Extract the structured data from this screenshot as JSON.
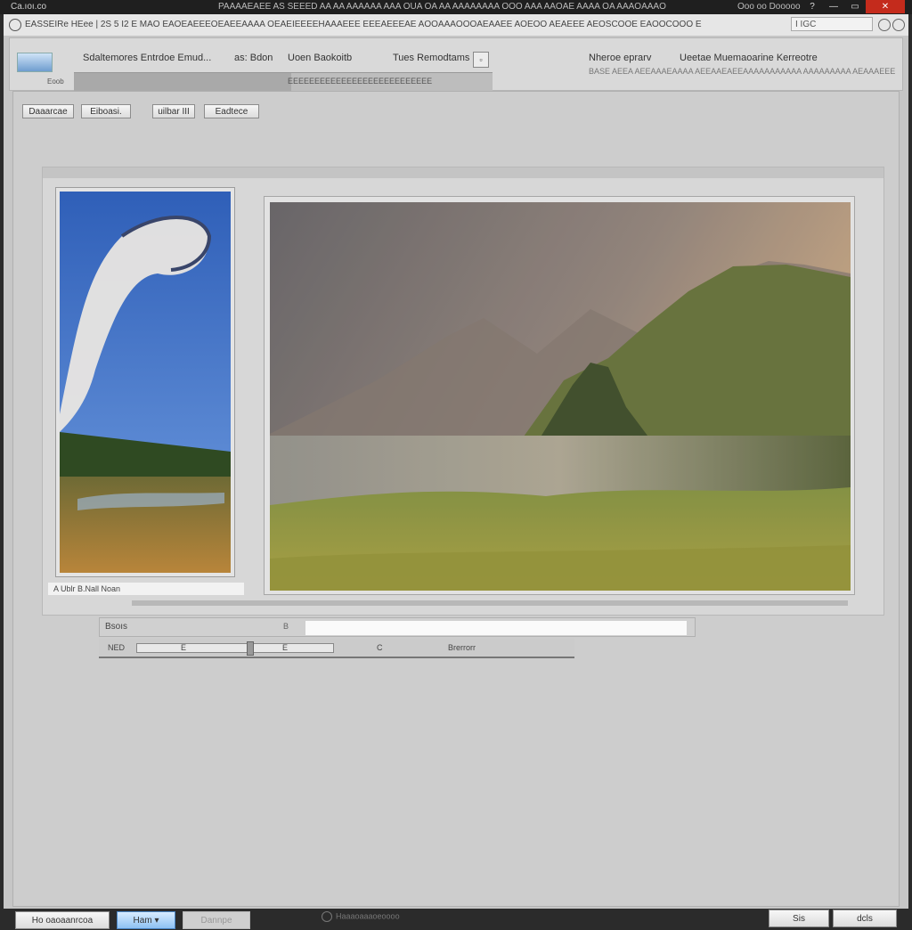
{
  "window": {
    "title": "Ca.ıoı.co",
    "center_text": "PAAAAEAEE AS SEEED AA AA AAAAAA AAA OUA OA AA AAAAAAAA OOO AAA AAOAE AAAA OA AAAOAAAO",
    "right_text": "Ooo oo Dooooo",
    "min_label": "—",
    "close_label": "✕"
  },
  "address": {
    "url": "EASSEIRe HEee | 2S 5 I2 E MAO EAOEAEEEOEAEEAAAA OEAEIEEEEHAAAEEE EEEAEEEAE AOOAAAOOOAEAAEE AOEOO AEAEEE AEOSCOOE EAOOCOOO EEEEEEEE",
    "search_value": "I  IGC"
  },
  "toolbar": {
    "item1": "Sdaltemores Entrdoe Emud...",
    "item2": "as: Bdon",
    "item3": "Uoen Baokoitb",
    "item4": "Tues Remodtams",
    "box_glyph": "▫",
    "progress": 0.52,
    "progress_text": "EEEEEEEEEEEEEEEEEEEEEEEEEEE",
    "small_label": "Eoob",
    "right1": "Nheroe eprarv",
    "right2": "Ueetae Muemaoarine Kerreotre",
    "right_sub": "BASE AEEA AEEAAAEAAAA AEEAAEAEEAAAAAAAAAAA AAAAAAAAA AEAAAEEE"
  },
  "controls": {
    "btn1": "Daaarcae",
    "btn2": "Eiboasi.",
    "btn3": "uilbar",
    "btn3_glyph": "III",
    "btn4": "Eadtece"
  },
  "thumbnail": {
    "caption": "A Ublr B.Nall Noan"
  },
  "form": {
    "row1_label": "Bsoıs",
    "row1_marker": "B",
    "slider_label": "NED",
    "slider_value": 0.56,
    "slider_mid": "E",
    "slider_right": "E",
    "text_right1": "C",
    "text_right2": "Brerrorr"
  },
  "footer": {
    "btn1": "Ho oaoaanrcoa",
    "btn2": "Ham",
    "btn2_glyph": "▾",
    "btn3": "Dannpe",
    "status": "Haaaoaaaoeoooo",
    "ok_label": "Sis",
    "cancel_label": "dcls"
  },
  "colors": {
    "accent_blue": "#8ec1f3",
    "close_red": "#c42b1c",
    "panel_gray": "#c6c6c6"
  }
}
